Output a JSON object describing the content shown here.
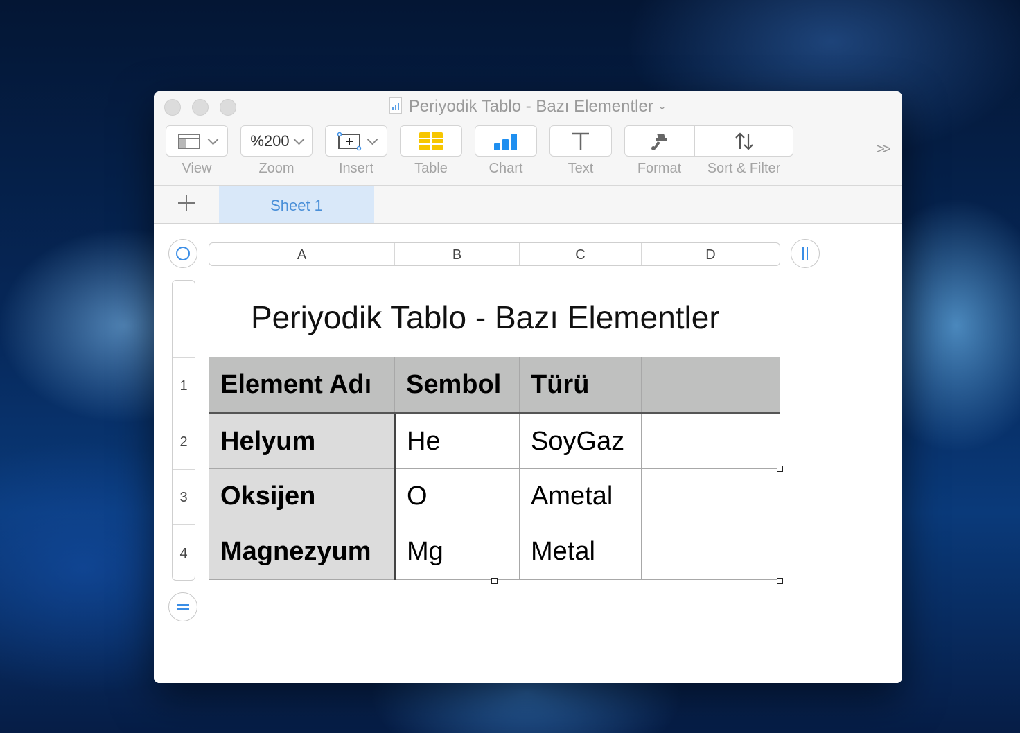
{
  "window": {
    "title": "Periyodik Tablo - Bazı Elementler"
  },
  "toolbar": {
    "view_label": "View",
    "zoom_value": "%200",
    "zoom_label": "Zoom",
    "insert_label": "Insert",
    "table_label": "Table",
    "chart_label": "Chart",
    "text_label": "Text",
    "format_label": "Format",
    "sort_filter_label": "Sort & Filter",
    "overflow_glyph": ">>"
  },
  "sheets": {
    "active_tab": "Sheet 1"
  },
  "grid": {
    "columns": [
      "A",
      "B",
      "C",
      "D"
    ],
    "rows": [
      "1",
      "2",
      "3",
      "4"
    ]
  },
  "document": {
    "title": "Periyodik Tablo - Bazı Elementler",
    "table": {
      "header": [
        "Element Adı",
        "Sembol",
        "Türü",
        ""
      ],
      "rows": [
        [
          "Helyum",
          "He",
          "SoyGaz",
          ""
        ],
        [
          "Oksijen",
          "O",
          "Ametal",
          ""
        ],
        [
          "Magnezyum",
          "Mg",
          "Metal",
          ""
        ]
      ]
    }
  },
  "colors": {
    "accent": "#4a8fd8",
    "header_fill": "#bfc0bf",
    "row_header_fill": "#dcdcdc",
    "table_icon": "#f7c600",
    "chart_icon": "#1f8ff0"
  }
}
